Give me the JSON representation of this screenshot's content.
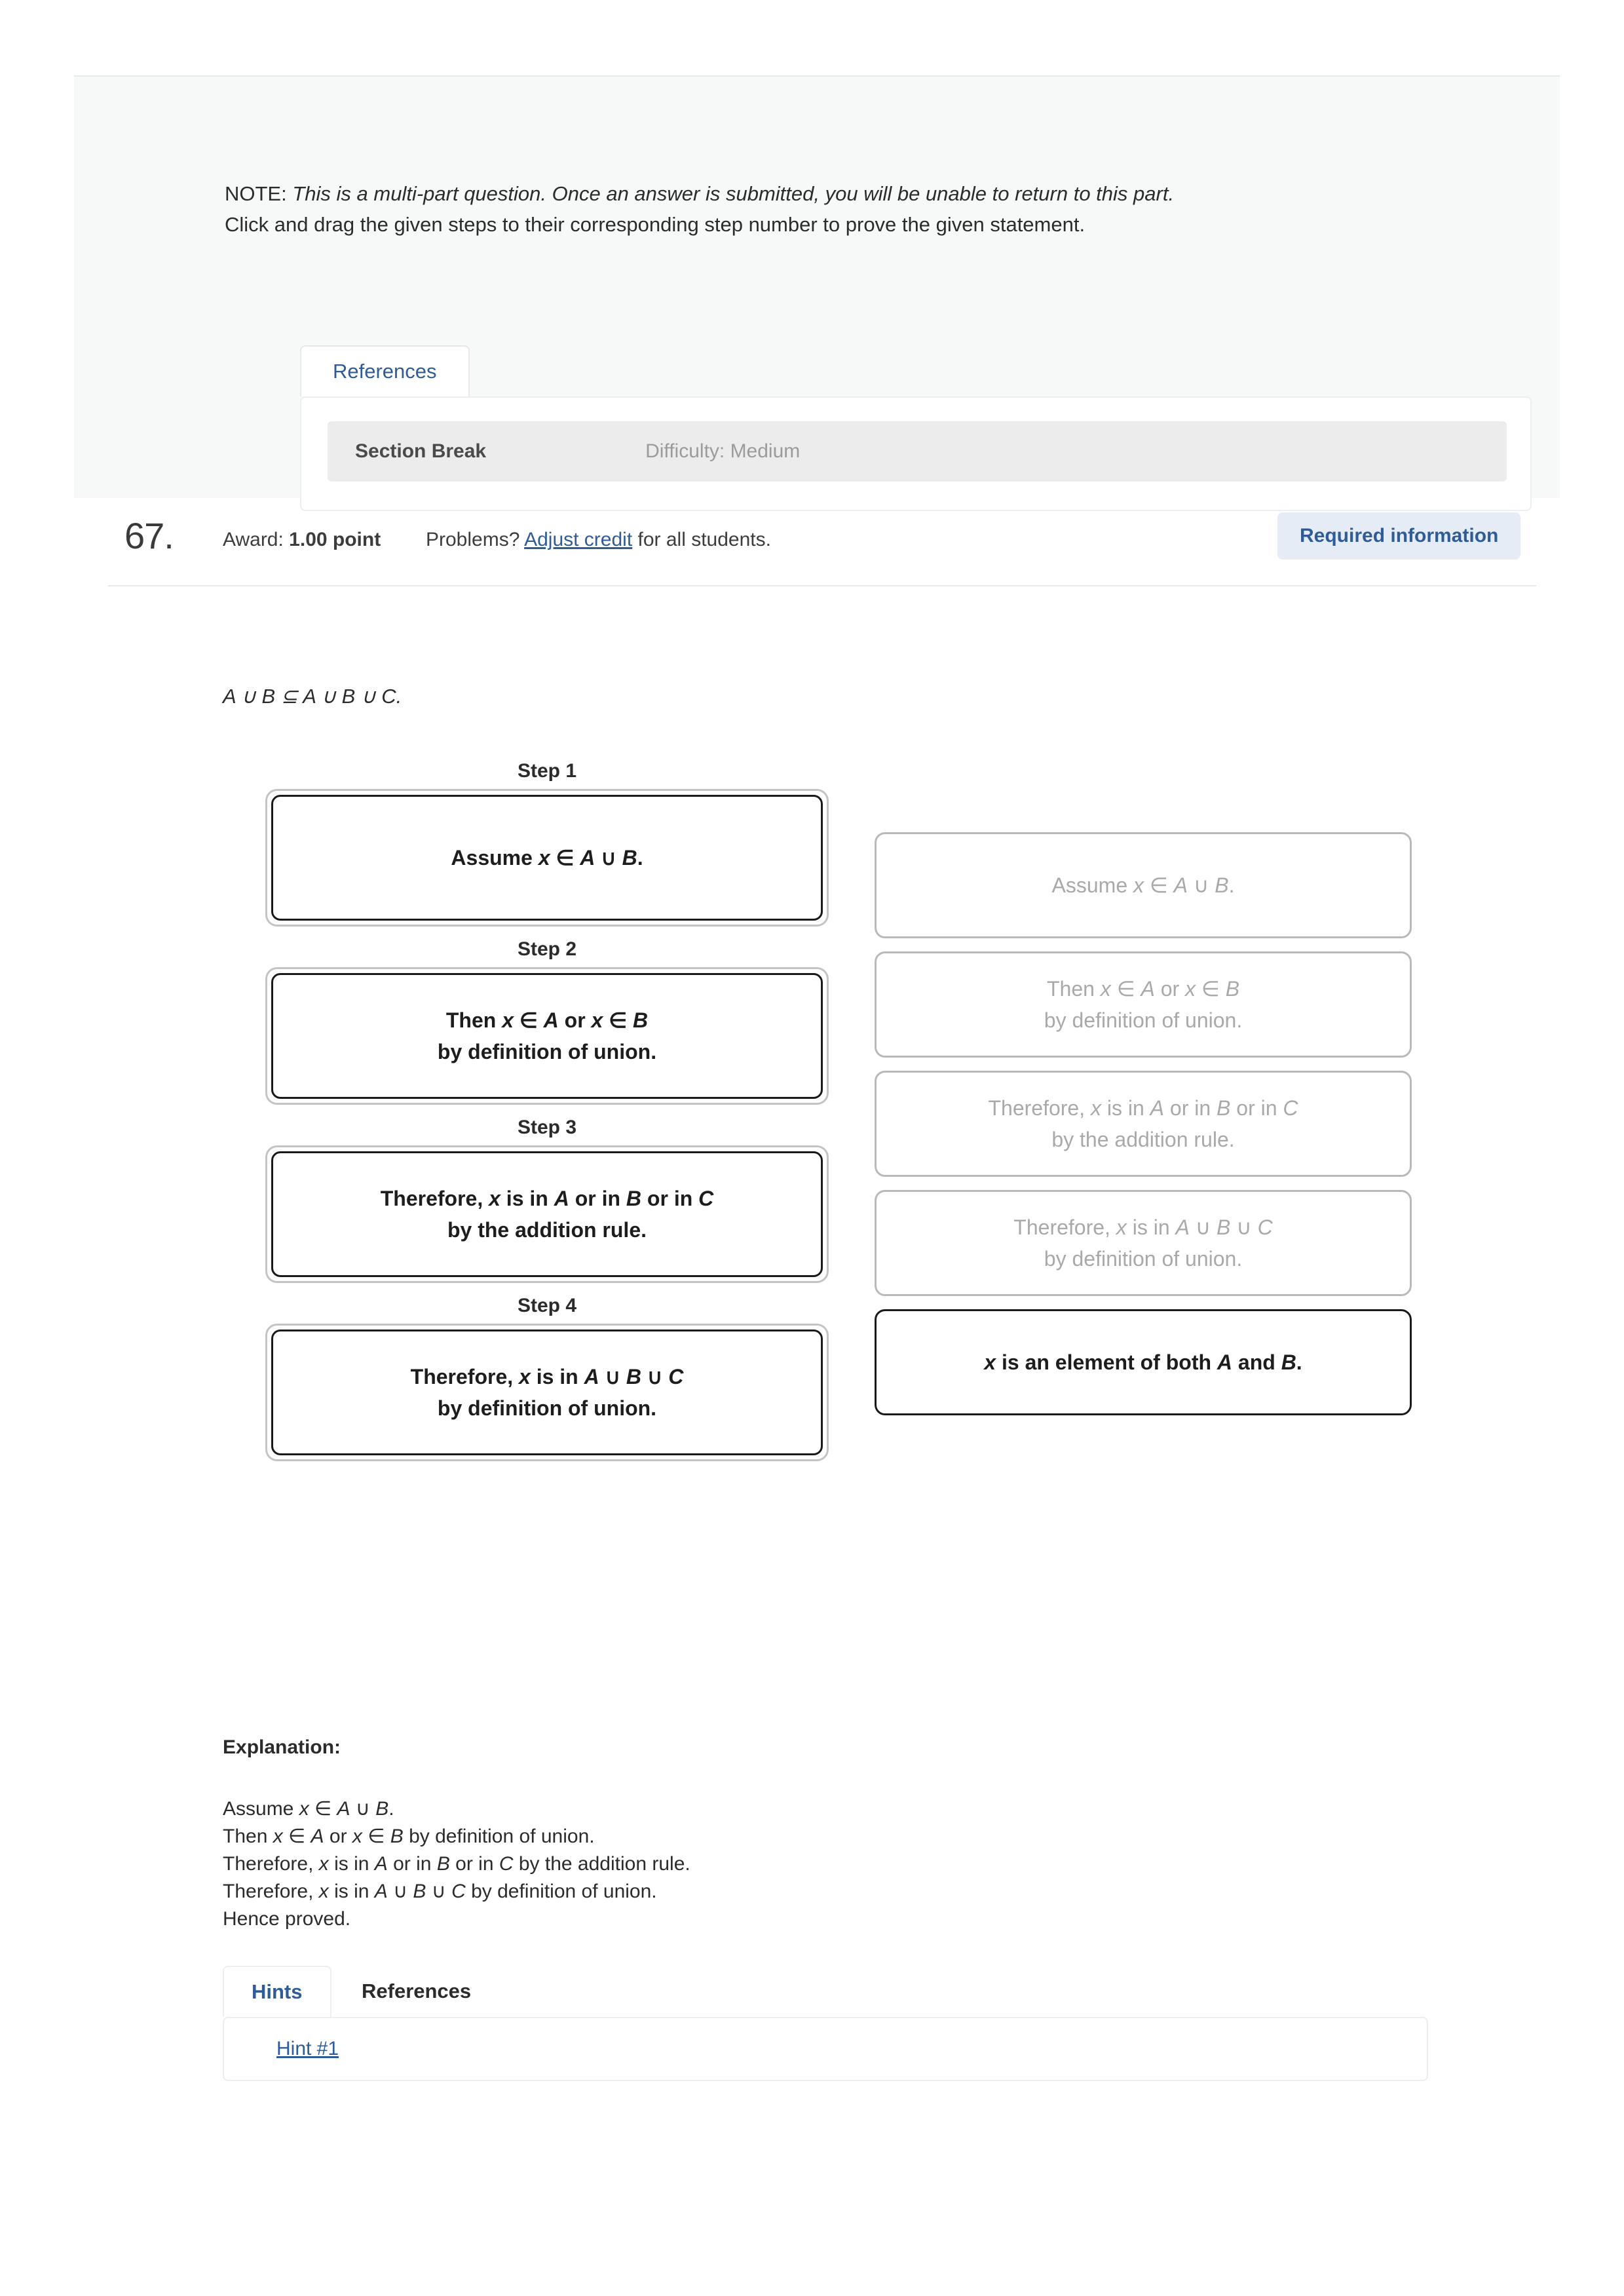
{
  "note": {
    "prefix": "NOTE:",
    "italic_part": "This is a multi-part question. Once an answer is submitted, you will be unable to return to this part.",
    "line2": "Click and drag the given steps to their corresponding step number to prove the given statement."
  },
  "top_tabs": {
    "references_label": "References"
  },
  "references_card": {
    "section_break_label": "Section Break",
    "difficulty_label": "Difficulty: Medium"
  },
  "award_row": {
    "question_number": "67.",
    "award_prefix": "Award:",
    "award_value": "1.00 point",
    "problems_prefix": "Problems?",
    "adjust_credit_link": "Adjust credit",
    "problems_suffix": "for all students.",
    "required_information_badge": "Required information"
  },
  "statement": {
    "text": "A ∪ B ⊆ A ∪ B ∪ C."
  },
  "dnd": {
    "step_labels": [
      "Step 1",
      "Step 2",
      "Step 3",
      "Step 4"
    ],
    "placed_steps": [
      {
        "line1": "Assume x ∈ A ∪ B.",
        "line2": ""
      },
      {
        "line1": "Then x ∈ A or x ∈ B",
        "line2": "by definition of union."
      },
      {
        "line1": "Therefore, x is in A or in B or in C",
        "line2": "by the addition rule."
      },
      {
        "line1": "Therefore, x is in A ∪ B ∪ C",
        "line2": "by definition of union."
      }
    ],
    "source_items": [
      {
        "line1": "Assume x ∈ A ∪ B.",
        "line2": "",
        "state": "used"
      },
      {
        "line1": "Then x ∈ A or x ∈ B",
        "line2": "by definition of union.",
        "state": "used"
      },
      {
        "line1": "Therefore, x is in A or in B or in C",
        "line2": "by the addition rule.",
        "state": "used"
      },
      {
        "line1": "Therefore, x is in A ∪ B ∪ C",
        "line2": "by definition of union.",
        "state": "used"
      },
      {
        "line1": "x is an element of both A and B.",
        "line2": "",
        "state": "available"
      }
    ]
  },
  "explanation": {
    "title": "Explanation:",
    "lines": [
      "Assume x ∈ A ∪ B.",
      "Then x ∈ A or x ∈ B by definition of union.",
      "Therefore, x is in A or in B or in C by the addition rule.",
      "Therefore, x is in A ∪ B ∪ C by definition of union.",
      "Hence proved."
    ]
  },
  "bottom_tabs": {
    "hints_label": "Hints",
    "references_label": "References",
    "hint_1_link": "Hint #1"
  },
  "colors": {
    "link_blue": "#2f5c96",
    "badge_bg": "#e6ecf5",
    "panel_grey": "#f7f8f8",
    "row_grey": "#ececec",
    "used_text_grey": "#a9a9a9"
  }
}
